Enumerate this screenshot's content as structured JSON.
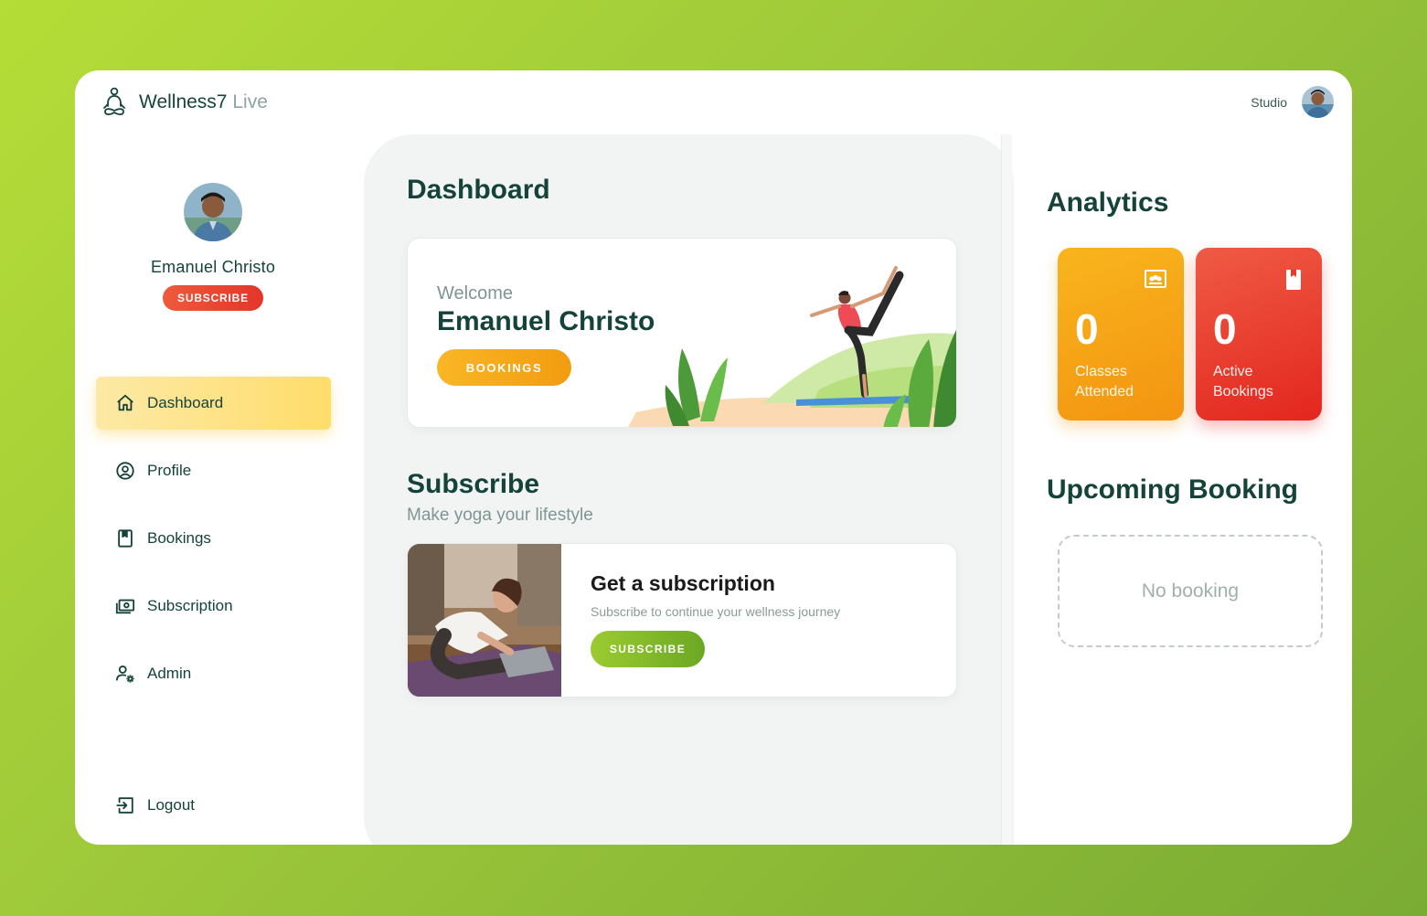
{
  "brand": {
    "name": "Wellness7",
    "suffix": "Live",
    "logo_icon": "meditation-icon"
  },
  "header": {
    "studio_label": "Studio"
  },
  "profile": {
    "name": "Emanuel Christo",
    "subscribe_label": "SUBSCRIBE"
  },
  "nav": {
    "items": [
      {
        "label": "Dashboard",
        "icon": "home-icon",
        "active": true
      },
      {
        "label": "Profile",
        "icon": "user-circle-icon",
        "active": false
      },
      {
        "label": "Bookings",
        "icon": "bookmark-icon",
        "active": false
      },
      {
        "label": "Subscription",
        "icon": "money-icon",
        "active": false
      },
      {
        "label": "Admin",
        "icon": "user-gear-icon",
        "active": false
      }
    ],
    "logout": {
      "label": "Logout",
      "icon": "logout-icon"
    }
  },
  "main": {
    "title": "Dashboard",
    "welcome": {
      "greeting": "Welcome",
      "name": "Emanuel Christo",
      "button_label": "BOOKINGS"
    },
    "subscribe": {
      "title": "Subscribe",
      "subtitle": "Make yoga your lifestyle",
      "card_title": "Get a subscription",
      "card_description": "Subscribe to continue your wellness journey",
      "button_label": "SUBSCRIBE"
    }
  },
  "analytics": {
    "title": "Analytics",
    "cards": [
      {
        "value": "0",
        "label": "Classes Attended",
        "icon": "classroom-icon",
        "color": "#f5a416"
      },
      {
        "value": "0",
        "label": "Active Bookings",
        "icon": "bookmark-icon",
        "color": "#e8392b"
      }
    ]
  },
  "upcoming": {
    "title": "Upcoming Booking",
    "empty_text": "No booking"
  },
  "colors": {
    "accent_green": "#7ab52b",
    "dark_text": "#15433a",
    "accent_orange": "#f5a416",
    "accent_red": "#e8392b"
  }
}
